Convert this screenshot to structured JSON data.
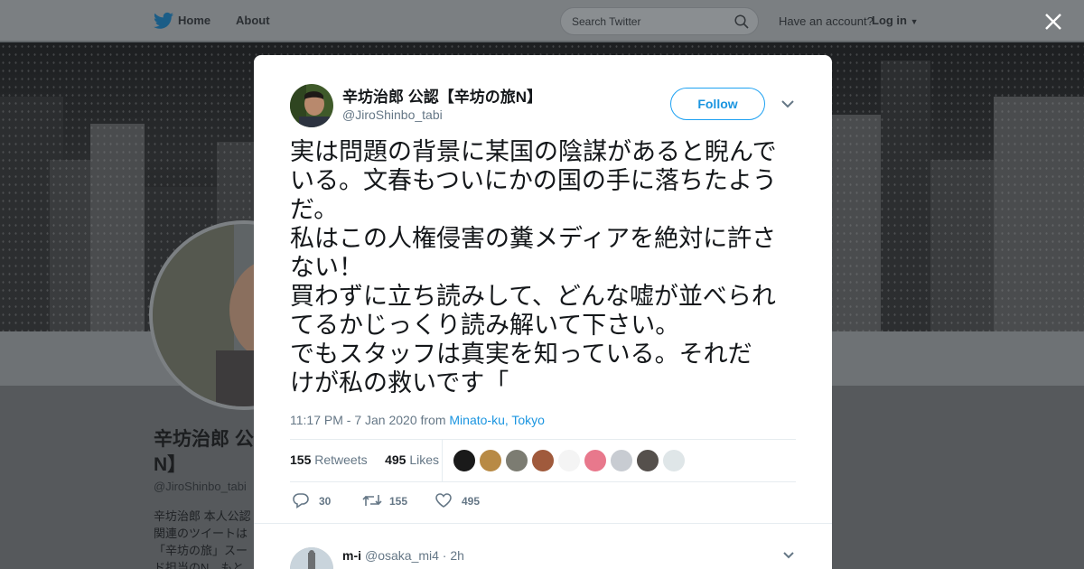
{
  "nav": {
    "home_label": "Home",
    "about_label": "About",
    "search_placeholder": "Search Twitter",
    "have_account": "Have an account?",
    "login_label": "Log in"
  },
  "background_profile": {
    "name_line1": "辛坊治郎 公",
    "name_line2": "N】",
    "handle": "@JiroShinbo_tabi",
    "bio_lines": [
      "辛坊治郎 本人公認",
      "関連のツイートは",
      "「辛坊の旅」スー",
      "ド担当のN、もと"
    ]
  },
  "tweet": {
    "author_name": "辛坊治郎 公認【辛坊の旅N】",
    "author_handle": "@JiroShinbo_tabi",
    "follow_label": "Follow",
    "text_lines": [
      "実は問題の背景に某国の陰謀があると睨んで",
      "いる。文春もついにかの国の手に落ちたよう",
      "だ。",
      "私はこの人権侵害の糞メディアを絶対に許さ",
      "ない！",
      "買わずに立ち読みして、どんな嘘が並べられ",
      "てるかじっくり読み解いて下さい。",
      "でもスタッフは真実を知っている。それだ",
      "けが私の救いです「"
    ],
    "timestamp": "11:17 PM - 7 Jan 2020 from",
    "location": "Minato-ku, Tokyo",
    "retweets_count": "155",
    "retweets_label": "Retweets",
    "likes_count": "495",
    "likes_label": "Likes",
    "likers": [
      "#1a1a1a",
      "#b88a45",
      "#7c7c72",
      "#a05a3c",
      "#f4f4f4",
      "#e8788c",
      "#c8ccd2",
      "#55504c",
      "#dfe6e8"
    ],
    "actions": {
      "reply_count": "30",
      "retweet_count": "155",
      "like_count": "495"
    }
  },
  "reply": {
    "name": "m-i",
    "handle_time": "@osaka_mi4 · 2h"
  },
  "colors": {
    "accent": "#1da1f2",
    "link": "#1b95e0",
    "muted": "#657786"
  }
}
